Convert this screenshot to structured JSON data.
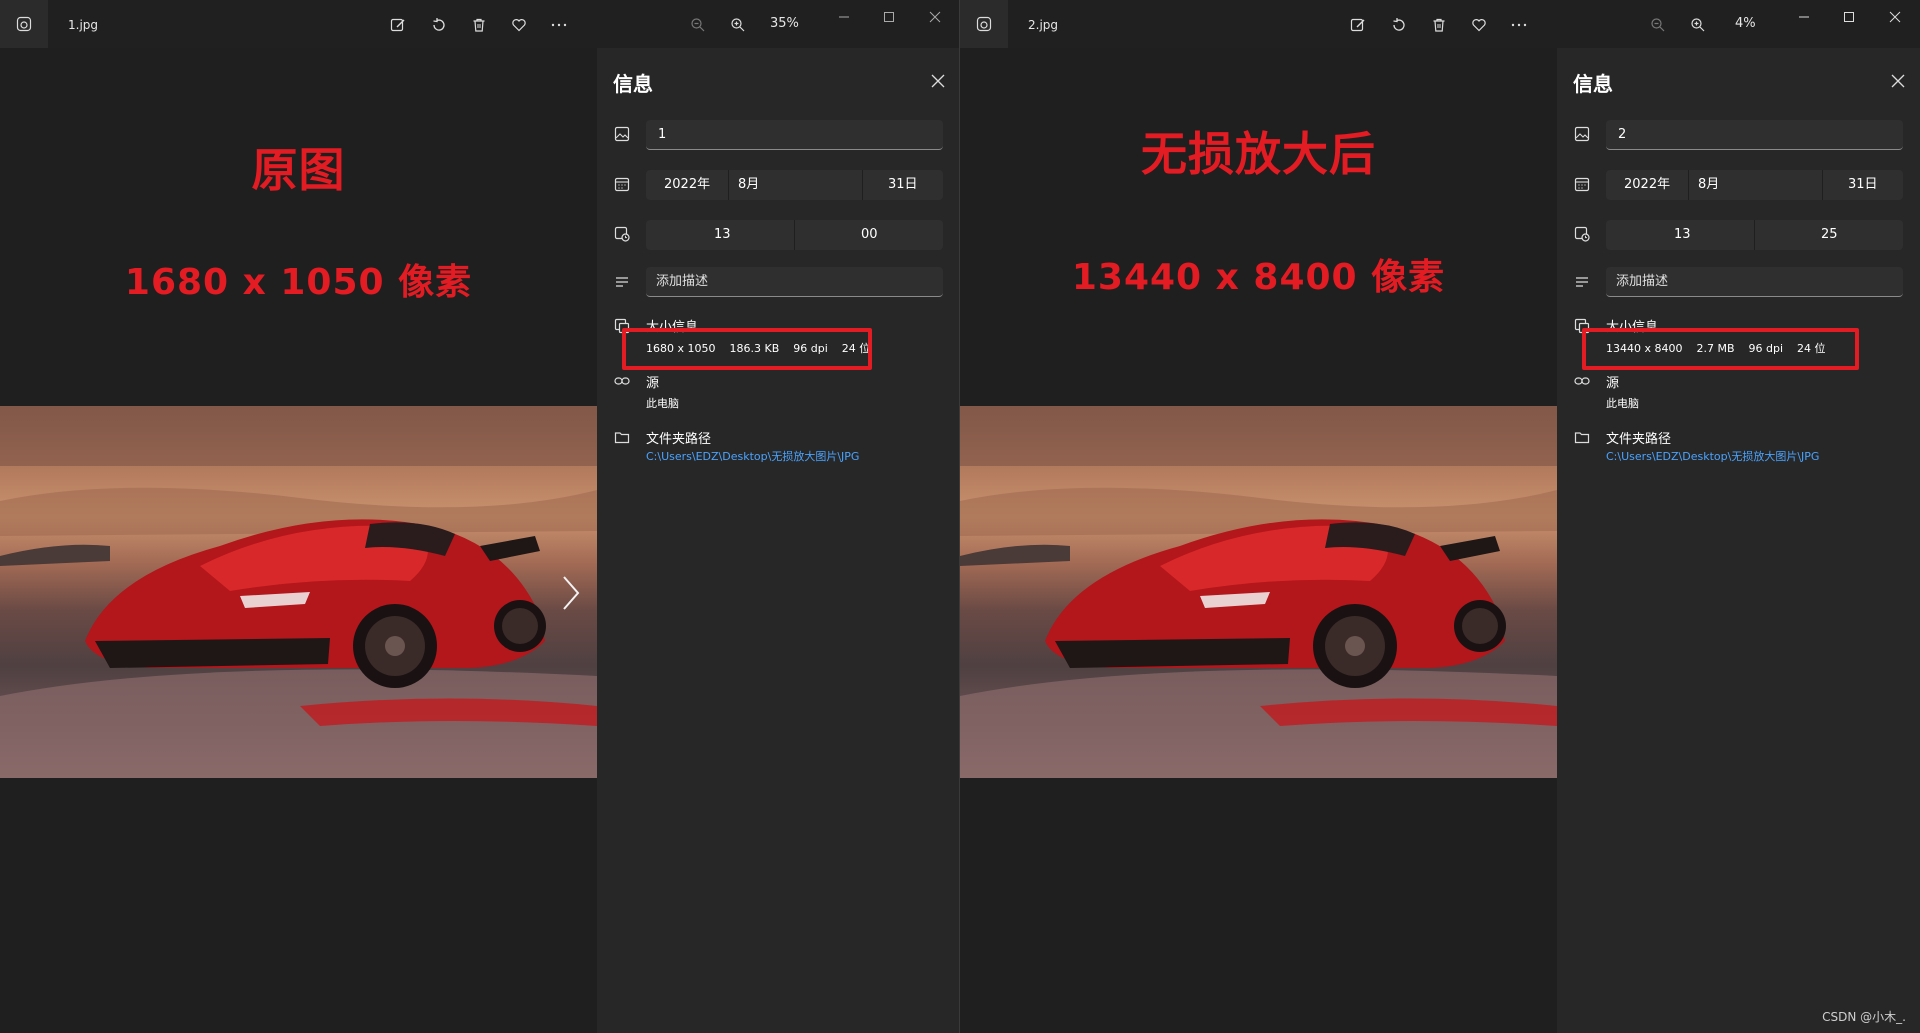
{
  "colors": {
    "accent_red": "#e31b23",
    "link_blue": "#4aa3ff",
    "panel_bg": "#272727"
  },
  "left": {
    "filename": "1.jpg",
    "zoom": "35%",
    "annotation": {
      "title": "原图",
      "resolution": "1680 x 1050 像素"
    },
    "info": {
      "title": "信息",
      "name_value": "1",
      "date": {
        "year": "2022年",
        "month": "8月",
        "day": "31日"
      },
      "time": {
        "hour": "13",
        "minute": "00"
      },
      "description_placeholder": "添加描述",
      "size_label": "大小信息",
      "size": {
        "dimensions": "1680 x 1050",
        "filesize": "186.3 KB",
        "dpi": "96 dpi",
        "bits": "24 位"
      },
      "source_label": "源",
      "source_value": "此电脑",
      "path_label": "文件夹路径",
      "path_value": "C:\\Users\\EDZ\\Desktop\\无损放大图片\\JPG"
    }
  },
  "right": {
    "filename": "2.jpg",
    "zoom": "4%",
    "annotation": {
      "title": "无损放大后",
      "resolution": "13440 x 8400 像素"
    },
    "info": {
      "title": "信息",
      "name_value": "2",
      "date": {
        "year": "2022年",
        "month": "8月",
        "day": "31日"
      },
      "time": {
        "hour": "13",
        "minute": "25"
      },
      "description_placeholder": "添加描述",
      "size_label": "大小信息",
      "size": {
        "dimensions": "13440 x 8400",
        "filesize": "2.7 MB",
        "dpi": "96 dpi",
        "bits": "24 位"
      },
      "source_label": "源",
      "source_value": "此电脑",
      "path_label": "文件夹路径",
      "path_value": "C:\\Users\\EDZ\\Desktop\\无损放大图片\\JPG"
    }
  },
  "watermark": "CSDN @小木_."
}
